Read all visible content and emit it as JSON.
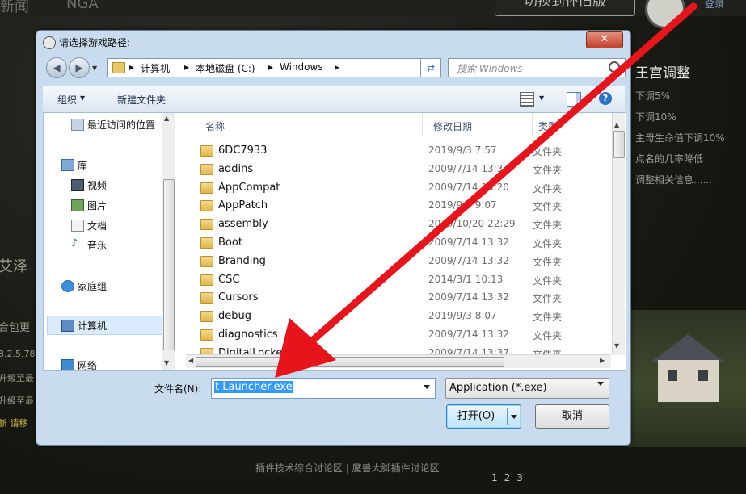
{
  "background": {
    "tab_texts": [
      "新闻",
      "NGA"
    ],
    "switch_button": "切换到怀旧版",
    "login": "登录",
    "panel_title": "王宫调整",
    "panel_lines": [
      "下调5%",
      "下调10%",
      "主母生命值下调10%",
      "点名的几率降低",
      "调整相关信息......"
    ],
    "left_texts": [
      "艾泽",
      "合包更",
      "8.2.5.78",
      "升级至最",
      "升级至最",
      "新 请移"
    ],
    "footer_links": "插件技术综合讨论区 | 魔兽大脚插件讨论区",
    "pager": [
      "1",
      "2",
      "3"
    ]
  },
  "dialog": {
    "title": "请选择游戏路径:",
    "close_label": "✕",
    "breadcrumb": [
      "计算机",
      "本地磁盘 (C:)",
      "Windows"
    ],
    "search_placeholder": "搜索 Windows",
    "toolbar": {
      "organize": "组织",
      "new_folder": "新建文件夹"
    },
    "nav_items": [
      {
        "label": "最近访问的位置",
        "icon": "recent-places-icon"
      },
      {
        "label": "库",
        "icon": "library-icon"
      },
      {
        "label": "视频",
        "icon": "video-icon"
      },
      {
        "label": "图片",
        "icon": "picture-icon"
      },
      {
        "label": "文档",
        "icon": "document-icon"
      },
      {
        "label": "音乐",
        "icon": "music-icon"
      },
      {
        "label": "家庭组",
        "icon": "homegroup-icon"
      },
      {
        "label": "计算机",
        "icon": "computer-icon"
      },
      {
        "label": "网络",
        "icon": "network-icon"
      }
    ],
    "columns": {
      "name": "名称",
      "date": "修改日期",
      "type": "类型"
    },
    "files": [
      {
        "name": "6DC7933",
        "date": "2019/9/3 7:57",
        "type": "文件夹"
      },
      {
        "name": "addins",
        "date": "2009/7/14 13:32",
        "type": "文件夹"
      },
      {
        "name": "AppCompat",
        "date": "2009/7/14 13:20",
        "type": "文件夹"
      },
      {
        "name": "AppPatch",
        "date": "2019/9/3 9:07",
        "type": "文件夹"
      },
      {
        "name": "assembly",
        "date": "2019/10/20 22:29",
        "type": "文件夹"
      },
      {
        "name": "Boot",
        "date": "2009/7/14 13:32",
        "type": "文件夹"
      },
      {
        "name": "Branding",
        "date": "2009/7/14 13:32",
        "type": "文件夹"
      },
      {
        "name": "CSC",
        "date": "2014/3/1 10:13",
        "type": "文件夹"
      },
      {
        "name": "Cursors",
        "date": "2009/7/14 13:32",
        "type": "文件夹"
      },
      {
        "name": "debug",
        "date": "2019/9/3 8:07",
        "type": "文件夹"
      },
      {
        "name": "diagnostics",
        "date": "2009/7/14 13:32",
        "type": "文件夹"
      },
      {
        "name": "DigitalLocker",
        "date": "2009/7/14 13:37",
        "type": "文件夹"
      }
    ],
    "filename_label": "文件名(N):",
    "filename_value": "t Launcher.exe",
    "filter_value": "Application (*.exe)",
    "open_button": "打开(O)",
    "cancel_button": "取消"
  },
  "annotation_color": "#e8141c"
}
